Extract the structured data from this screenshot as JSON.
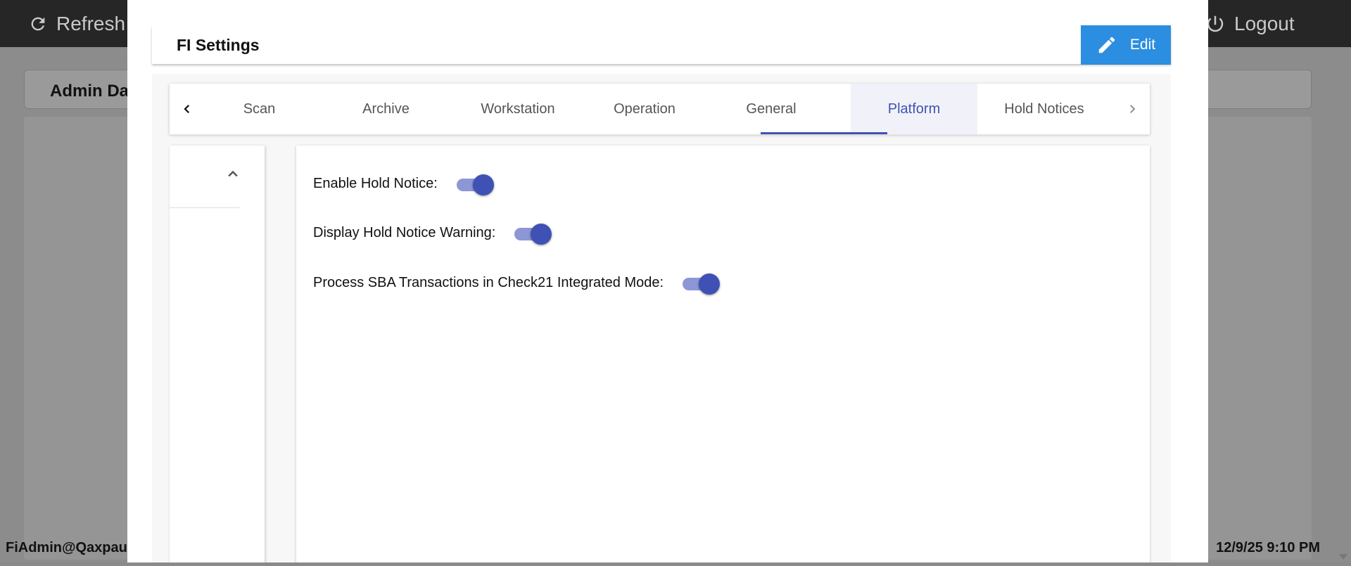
{
  "background": {
    "topbar": {
      "refresh_label": "Refresh",
      "logout_label": "Logout"
    },
    "card_title": "Admin Da",
    "footer": {
      "user": "FiAdmin@Qaxpaut",
      "datetime": "12/9/25 9:10 PM"
    }
  },
  "modal": {
    "title": "FI Settings",
    "edit_label": "Edit",
    "tabs": [
      {
        "label": "Scan",
        "active": false
      },
      {
        "label": "Archive",
        "active": false
      },
      {
        "label": "Workstation",
        "active": false
      },
      {
        "label": "Operation",
        "active": false
      },
      {
        "label": "General",
        "active": false
      },
      {
        "label": "Platform",
        "active": true
      },
      {
        "label": "Hold Notices",
        "active": false
      }
    ],
    "settings": [
      {
        "label": "Enable Hold Notice:",
        "enabled": true
      },
      {
        "label": "Display Hold Notice Warning:",
        "enabled": true
      },
      {
        "label": "Process SBA Transactions in Check21 Integrated Mode:",
        "enabled": true
      }
    ]
  },
  "colors": {
    "accent": "#3f51b5",
    "toggle_track": "#8e97d5",
    "edit_button": "#2b8ee0",
    "topbar": "#262626"
  }
}
